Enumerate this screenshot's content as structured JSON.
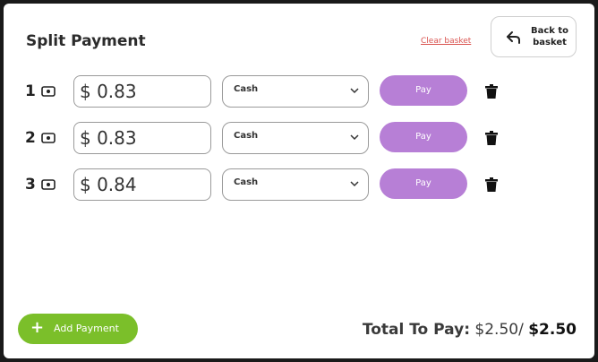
{
  "header": {
    "title": "Split Payment",
    "clear_label": "Clear basket",
    "back_label_line1": "Back to",
    "back_label_line2": "basket"
  },
  "payments": [
    {
      "index": "1",
      "amount": "$ 0.83",
      "method": "Cash",
      "pay_label": "Pay"
    },
    {
      "index": "2",
      "amount": "$ 0.83",
      "method": "Cash",
      "pay_label": "Pay"
    },
    {
      "index": "3",
      "amount": "$ 0.84",
      "method": "Cash",
      "pay_label": "Pay"
    }
  ],
  "footer": {
    "add_label": "Add Payment",
    "total_label": "Total To Pay:",
    "total_paid": "$2.50/",
    "total_due": "$2.50"
  },
  "colors": {
    "pay_button": "#b77fd6",
    "add_button": "#7bbf2a",
    "clear_link": "#d9534f"
  },
  "icons": [
    "back-arrow-icon",
    "cash-icon",
    "chevron-down-icon",
    "trash-icon",
    "plus-icon"
  ]
}
